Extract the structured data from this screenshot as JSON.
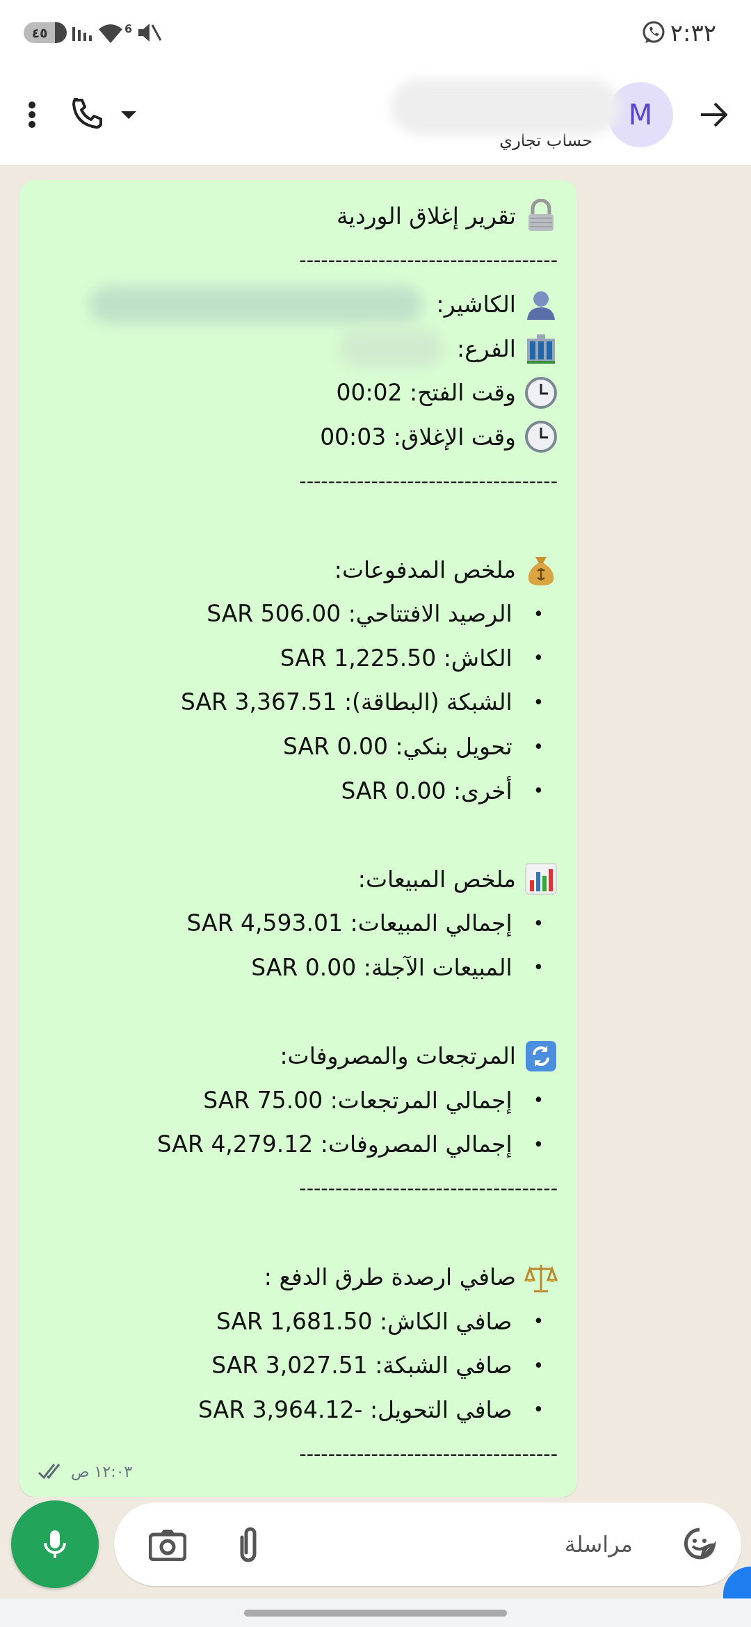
{
  "status_bar": {
    "time": "٢:٣٢",
    "battery": "٤٥",
    "network": "6"
  },
  "header": {
    "avatar_letter": "M",
    "subtitle": "حساب تجاري"
  },
  "message": {
    "blocks": [
      {
        "kind": "title",
        "text": "تقرير إغلاق الوردية"
      },
      {
        "kind": "divider",
        "text": "------------------------------------"
      },
      {
        "kind": "field",
        "text": "الكاشير:",
        "redacted": true
      },
      {
        "kind": "field",
        "text": "الفرع:",
        "redacted": true
      },
      {
        "kind": "field",
        "text": "وقت الفتح:  00:02",
        "redacted": false
      },
      {
        "kind": "field",
        "text": "وقت الإغلاق:  00:03",
        "redacted": false
      },
      {
        "kind": "divider",
        "text": "------------------------------------"
      },
      {
        "kind": "spacer"
      },
      {
        "kind": "section",
        "heading": "ملخص المدفوعات:",
        "items": [
          {
            "bullet": "•",
            "text": "الرصيد الافتتاحي: 506.00 SAR"
          },
          {
            "bullet": "•",
            "text": "الكاش: 1,225.50 SAR"
          },
          {
            "bullet": "•",
            "text": "الشبكة (البطاقة): 3,367.51 SAR"
          },
          {
            "bullet": "•",
            "text": "تحويل بنكي: 0.00 SAR"
          },
          {
            "bullet": "•",
            "text": "أخرى: 0.00 SAR"
          }
        ]
      },
      {
        "kind": "spacer"
      },
      {
        "kind": "section",
        "heading": "ملخص المبيعات:",
        "items": [
          {
            "bullet": "•",
            "text": "إجمالي المبيعات: 4,593.01 SAR"
          },
          {
            "bullet": "•",
            "text": "المبيعات الآجلة: 0.00 SAR"
          }
        ]
      },
      {
        "kind": "spacer"
      },
      {
        "kind": "section",
        "heading": "المرتجعات والمصروفات:",
        "items": [
          {
            "bullet": "•",
            "text": "إجمالي المرتجعات: 75.00 SAR"
          },
          {
            "bullet": "•",
            "text": "إجمالي المصروفات: 4,279.12 SAR"
          }
        ]
      },
      {
        "kind": "divider",
        "text": "------------------------------------"
      },
      {
        "kind": "spacer"
      },
      {
        "kind": "section",
        "heading": "صافي ارصدة طرق الدفع :",
        "items": [
          {
            "bullet": "•",
            "text": "صافي الكاش: 1,681.50 SAR"
          },
          {
            "bullet": "•",
            "text": "صافي الشبكة: 3,027.51 SAR"
          },
          {
            "bullet": "•",
            "text": "صافي التحويل: -3,964.12 SAR"
          }
        ]
      },
      {
        "kind": "divider",
        "text": "------------------------------------"
      }
    ],
    "time": "١٢:٠٣ ص",
    "read": false
  },
  "composer": {
    "placeholder": "مراسلة"
  }
}
